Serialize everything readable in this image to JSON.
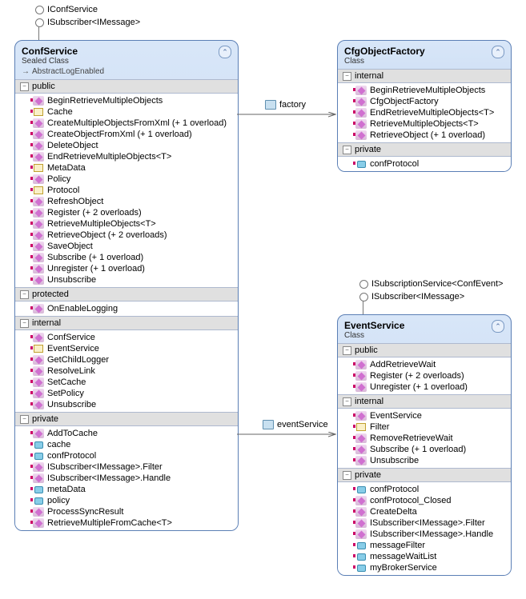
{
  "interfaces": {
    "confService": [
      "IConfService",
      "ISubscriber<IMessage>"
    ],
    "eventService": [
      "ISubscriptionService<ConfEvent>",
      "ISubscriber<IMessage>"
    ]
  },
  "classes": {
    "confService": {
      "name": "ConfService",
      "kind": "Sealed Class",
      "tag": "AbstractLogEnabled",
      "sections": [
        {
          "name": "public",
          "members": [
            {
              "t": "m",
              "n": "BeginRetrieveMultipleObjects"
            },
            {
              "t": "p",
              "n": "Cache"
            },
            {
              "t": "m",
              "n": "CreateMultipleObjectsFromXml (+ 1 overload)"
            },
            {
              "t": "m",
              "n": "CreateObjectFromXml (+ 1 overload)"
            },
            {
              "t": "m",
              "n": "DeleteObject"
            },
            {
              "t": "m",
              "n": "EndRetrieveMultipleObjects<T>"
            },
            {
              "t": "p",
              "n": "MetaData"
            },
            {
              "t": "m",
              "n": "Policy"
            },
            {
              "t": "p",
              "n": "Protocol"
            },
            {
              "t": "m",
              "n": "RefreshObject"
            },
            {
              "t": "m",
              "n": "Register (+ 2 overloads)"
            },
            {
              "t": "m",
              "n": "RetrieveMultipleObjects<T>"
            },
            {
              "t": "m",
              "n": "RetrieveObject (+ 2 overloads)"
            },
            {
              "t": "m",
              "n": "SaveObject"
            },
            {
              "t": "m",
              "n": "Subscribe (+ 1 overload)"
            },
            {
              "t": "m",
              "n": "Unregister (+ 1 overload)"
            },
            {
              "t": "m",
              "n": "Unsubscribe"
            }
          ]
        },
        {
          "name": "protected",
          "members": [
            {
              "t": "m",
              "n": "OnEnableLogging"
            }
          ]
        },
        {
          "name": "internal",
          "members": [
            {
              "t": "m",
              "n": "ConfService"
            },
            {
              "t": "p",
              "n": "EventService"
            },
            {
              "t": "m",
              "n": "GetChildLogger"
            },
            {
              "t": "m",
              "n": "ResolveLink"
            },
            {
              "t": "m",
              "n": "SetCache"
            },
            {
              "t": "m",
              "n": "SetPolicy"
            },
            {
              "t": "m",
              "n": "Unsubscribe"
            }
          ]
        },
        {
          "name": "private",
          "members": [
            {
              "t": "m",
              "n": "AddToCache"
            },
            {
              "t": "f",
              "n": "cache"
            },
            {
              "t": "f",
              "n": "confProtocol"
            },
            {
              "t": "m",
              "n": "ISubscriber<IMessage>.Filter"
            },
            {
              "t": "m",
              "n": "ISubscriber<IMessage>.Handle"
            },
            {
              "t": "f",
              "n": "metaData"
            },
            {
              "t": "f",
              "n": "policy"
            },
            {
              "t": "m",
              "n": "ProcessSyncResult"
            },
            {
              "t": "m",
              "n": "RetrieveMultipleFromCache<T>"
            }
          ]
        }
      ]
    },
    "cfgObjectFactory": {
      "name": "CfgObjectFactory",
      "kind": "Class",
      "sections": [
        {
          "name": "internal",
          "members": [
            {
              "t": "m",
              "n": "BeginRetrieveMultipleObjects"
            },
            {
              "t": "m",
              "n": "CfgObjectFactory"
            },
            {
              "t": "m",
              "n": "EndRetrieveMultipleObjects<T>"
            },
            {
              "t": "m",
              "n": "RetrieveMultipleObjects<T>"
            },
            {
              "t": "m",
              "n": "RetrieveObject (+ 1 overload)"
            }
          ]
        },
        {
          "name": "private",
          "members": [
            {
              "t": "f",
              "n": "confProtocol"
            }
          ]
        }
      ]
    },
    "eventService": {
      "name": "EventService",
      "kind": "Class",
      "sections": [
        {
          "name": "public",
          "members": [
            {
              "t": "m",
              "n": "AddRetrieveWait"
            },
            {
              "t": "m",
              "n": "Register (+ 2 overloads)"
            },
            {
              "t": "m",
              "n": "Unregister (+ 1 overload)"
            }
          ]
        },
        {
          "name": "internal",
          "members": [
            {
              "t": "m",
              "n": "EventService"
            },
            {
              "t": "p",
              "n": "Filter"
            },
            {
              "t": "m",
              "n": "RemoveRetrieveWait"
            },
            {
              "t": "m",
              "n": "Subscribe (+ 1 overload)"
            },
            {
              "t": "m",
              "n": "Unsubscribe"
            }
          ]
        },
        {
          "name": "private",
          "members": [
            {
              "t": "f",
              "n": "confProtocol"
            },
            {
              "t": "m",
              "n": "confProtocol_Closed"
            },
            {
              "t": "m",
              "n": "CreateDelta"
            },
            {
              "t": "m",
              "n": "ISubscriber<IMessage>.Filter"
            },
            {
              "t": "m",
              "n": "ISubscriber<IMessage>.Handle"
            },
            {
              "t": "f",
              "n": "messageFilter"
            },
            {
              "t": "f",
              "n": "messageWaitList"
            },
            {
              "t": "f",
              "n": "myBrokerService"
            }
          ]
        }
      ]
    }
  },
  "associations": {
    "factory": "factory",
    "eventService": "eventService"
  }
}
